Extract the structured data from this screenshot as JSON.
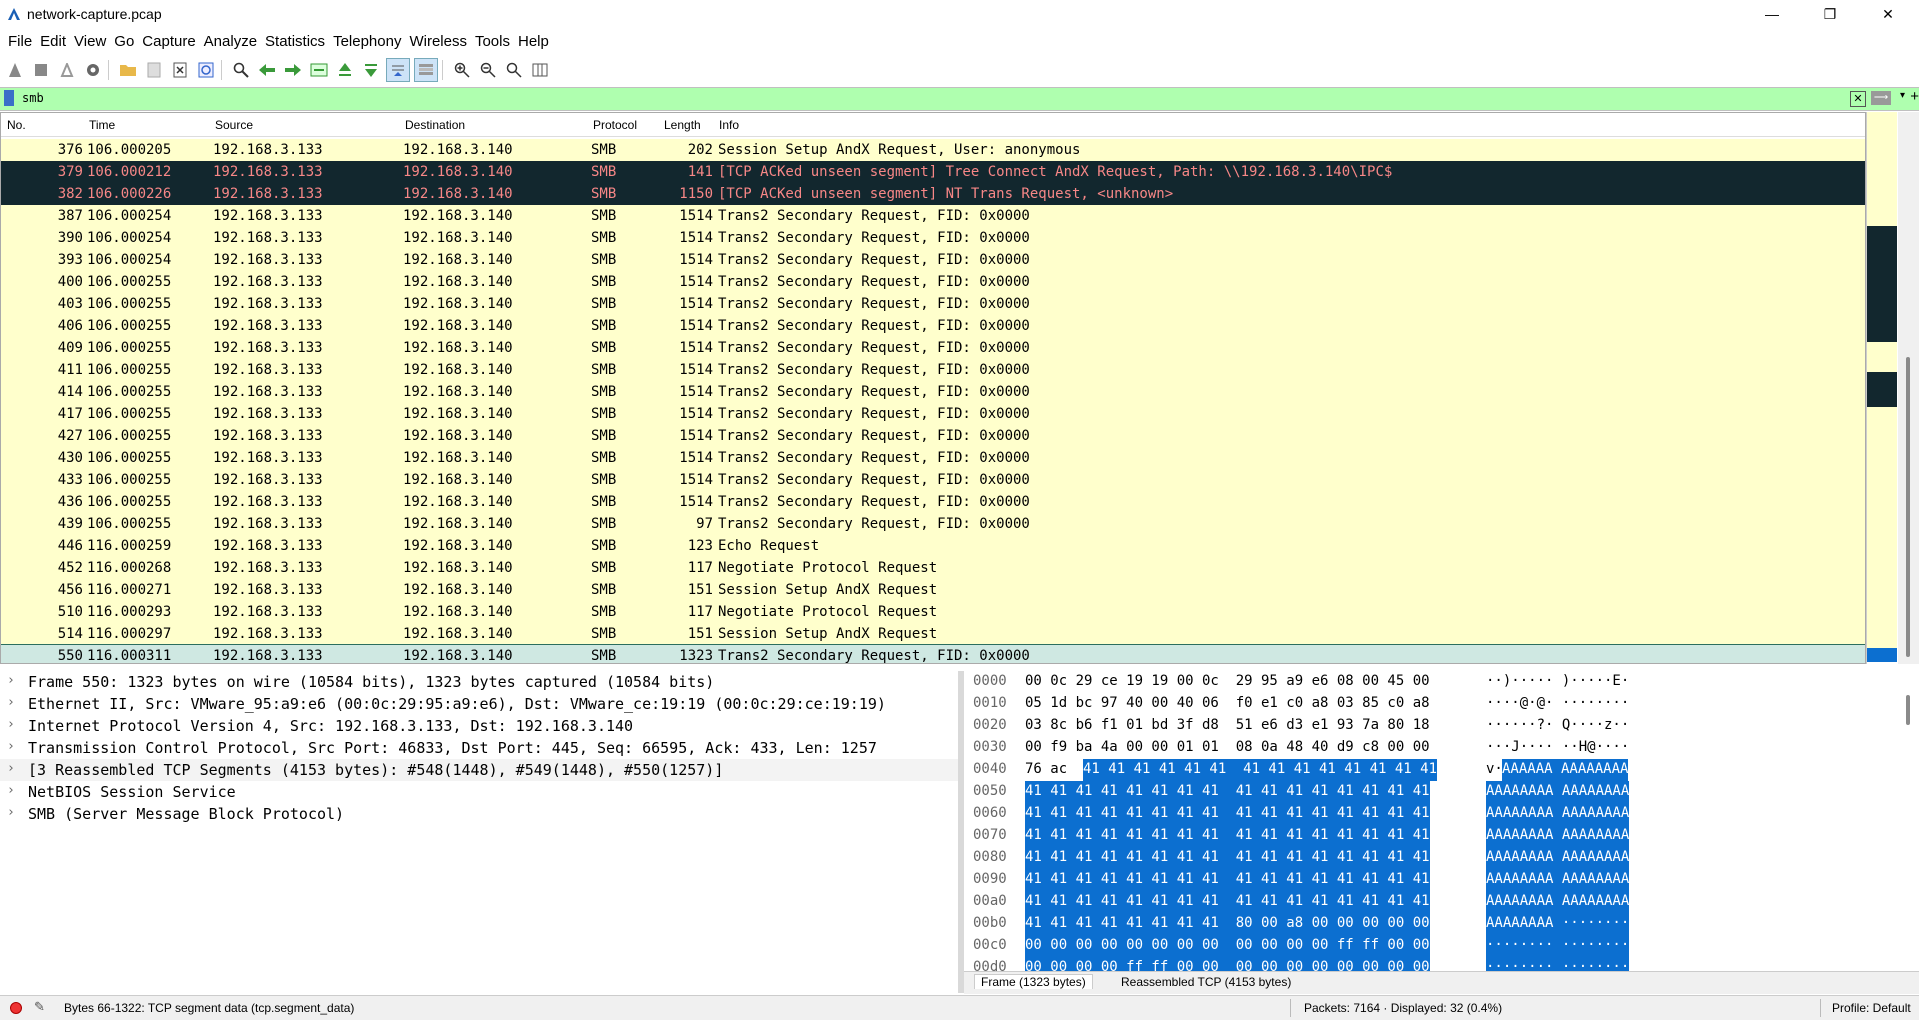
{
  "window": {
    "title": "network-capture.pcap",
    "minimize": "—",
    "restore": "❐",
    "close": "✕"
  },
  "menu": [
    {
      "label": "File",
      "mn": "F"
    },
    {
      "label": "Edit",
      "mn": "E"
    },
    {
      "label": "View",
      "mn": "V"
    },
    {
      "label": "Go",
      "mn": "G"
    },
    {
      "label": "Capture",
      "mn": "C"
    },
    {
      "label": "Analyze",
      "mn": "A"
    },
    {
      "label": "Statistics",
      "mn": "S"
    },
    {
      "label": "Telephony",
      "mn": "y"
    },
    {
      "label": "Wireless",
      "mn": "W"
    },
    {
      "label": "Tools",
      "mn": "T"
    },
    {
      "label": "Help",
      "mn": "H"
    }
  ],
  "filter": {
    "value": "smb",
    "bg_color": "#afffaf"
  },
  "columns": {
    "no": "No.",
    "time": "Time",
    "source": "Source",
    "destination": "Destination",
    "protocol": "Protocol",
    "length": "Length",
    "info": "Info"
  },
  "packets": [
    {
      "no": "376",
      "time": "106.000205",
      "src": "192.168.3.133",
      "dst": "192.168.3.140",
      "proto": "SMB",
      "len": "202",
      "info": "Session Setup AndX Request, User: anonymous",
      "style": "normal"
    },
    {
      "no": "379",
      "time": "106.000212",
      "src": "192.168.3.133",
      "dst": "192.168.3.140",
      "proto": "SMB",
      "len": "141",
      "info": "[TCP ACKed unseen segment] Tree Connect AndX Request, Path: \\\\192.168.3.140\\IPC$",
      "style": "dark"
    },
    {
      "no": "382",
      "time": "106.000226",
      "src": "192.168.3.133",
      "dst": "192.168.3.140",
      "proto": "SMB",
      "len": "1150",
      "info": "[TCP ACKed unseen segment] NT Trans Request, <unknown>",
      "style": "dark"
    },
    {
      "no": "387",
      "time": "106.000254",
      "src": "192.168.3.133",
      "dst": "192.168.3.140",
      "proto": "SMB",
      "len": "1514",
      "info": "Trans2 Secondary Request, FID: 0x0000",
      "style": "normal"
    },
    {
      "no": "390",
      "time": "106.000254",
      "src": "192.168.3.133",
      "dst": "192.168.3.140",
      "proto": "SMB",
      "len": "1514",
      "info": "Trans2 Secondary Request, FID: 0x0000",
      "style": "normal"
    },
    {
      "no": "393",
      "time": "106.000254",
      "src": "192.168.3.133",
      "dst": "192.168.3.140",
      "proto": "SMB",
      "len": "1514",
      "info": "Trans2 Secondary Request, FID: 0x0000",
      "style": "normal"
    },
    {
      "no": "400",
      "time": "106.000255",
      "src": "192.168.3.133",
      "dst": "192.168.3.140",
      "proto": "SMB",
      "len": "1514",
      "info": "Trans2 Secondary Request, FID: 0x0000",
      "style": "normal"
    },
    {
      "no": "403",
      "time": "106.000255",
      "src": "192.168.3.133",
      "dst": "192.168.3.140",
      "proto": "SMB",
      "len": "1514",
      "info": "Trans2 Secondary Request, FID: 0x0000",
      "style": "normal"
    },
    {
      "no": "406",
      "time": "106.000255",
      "src": "192.168.3.133",
      "dst": "192.168.3.140",
      "proto": "SMB",
      "len": "1514",
      "info": "Trans2 Secondary Request, FID: 0x0000",
      "style": "normal"
    },
    {
      "no": "409",
      "time": "106.000255",
      "src": "192.168.3.133",
      "dst": "192.168.3.140",
      "proto": "SMB",
      "len": "1514",
      "info": "Trans2 Secondary Request, FID: 0x0000",
      "style": "normal"
    },
    {
      "no": "411",
      "time": "106.000255",
      "src": "192.168.3.133",
      "dst": "192.168.3.140",
      "proto": "SMB",
      "len": "1514",
      "info": "Trans2 Secondary Request, FID: 0x0000",
      "style": "normal"
    },
    {
      "no": "414",
      "time": "106.000255",
      "src": "192.168.3.133",
      "dst": "192.168.3.140",
      "proto": "SMB",
      "len": "1514",
      "info": "Trans2 Secondary Request, FID: 0x0000",
      "style": "normal"
    },
    {
      "no": "417",
      "time": "106.000255",
      "src": "192.168.3.133",
      "dst": "192.168.3.140",
      "proto": "SMB",
      "len": "1514",
      "info": "Trans2 Secondary Request, FID: 0x0000",
      "style": "normal"
    },
    {
      "no": "427",
      "time": "106.000255",
      "src": "192.168.3.133",
      "dst": "192.168.3.140",
      "proto": "SMB",
      "len": "1514",
      "info": "Trans2 Secondary Request, FID: 0x0000",
      "style": "normal"
    },
    {
      "no": "430",
      "time": "106.000255",
      "src": "192.168.3.133",
      "dst": "192.168.3.140",
      "proto": "SMB",
      "len": "1514",
      "info": "Trans2 Secondary Request, FID: 0x0000",
      "style": "normal"
    },
    {
      "no": "433",
      "time": "106.000255",
      "src": "192.168.3.133",
      "dst": "192.168.3.140",
      "proto": "SMB",
      "len": "1514",
      "info": "Trans2 Secondary Request, FID: 0x0000",
      "style": "normal"
    },
    {
      "no": "436",
      "time": "106.000255",
      "src": "192.168.3.133",
      "dst": "192.168.3.140",
      "proto": "SMB",
      "len": "1514",
      "info": "Trans2 Secondary Request, FID: 0x0000",
      "style": "normal"
    },
    {
      "no": "439",
      "time": "106.000255",
      "src": "192.168.3.133",
      "dst": "192.168.3.140",
      "proto": "SMB",
      "len": "97",
      "info": "Trans2 Secondary Request, FID: 0x0000",
      "style": "normal"
    },
    {
      "no": "446",
      "time": "116.000259",
      "src": "192.168.3.133",
      "dst": "192.168.3.140",
      "proto": "SMB",
      "len": "123",
      "info": "Echo Request",
      "style": "normal"
    },
    {
      "no": "452",
      "time": "116.000268",
      "src": "192.168.3.133",
      "dst": "192.168.3.140",
      "proto": "SMB",
      "len": "117",
      "info": "Negotiate Protocol Request",
      "style": "normal"
    },
    {
      "no": "456",
      "time": "116.000271",
      "src": "192.168.3.133",
      "dst": "192.168.3.140",
      "proto": "SMB",
      "len": "151",
      "info": "Session Setup AndX Request",
      "style": "normal"
    },
    {
      "no": "510",
      "time": "116.000293",
      "src": "192.168.3.133",
      "dst": "192.168.3.140",
      "proto": "SMB",
      "len": "117",
      "info": "Negotiate Protocol Request",
      "style": "normal"
    },
    {
      "no": "514",
      "time": "116.000297",
      "src": "192.168.3.133",
      "dst": "192.168.3.140",
      "proto": "SMB",
      "len": "151",
      "info": "Session Setup AndX Request",
      "style": "normal"
    },
    {
      "no": "550",
      "time": "116.000311",
      "src": "192.168.3.133",
      "dst": "192.168.3.140",
      "proto": "SMB",
      "len": "1323",
      "info": "Trans2 Secondary Request, FID: 0x0000",
      "style": "sel"
    }
  ],
  "details": [
    "Frame 550: 1323 bytes on wire (10584 bits), 1323 bytes captured (10584 bits)",
    "Ethernet II, Src: VMware_95:a9:e6 (00:0c:29:95:a9:e6), Dst: VMware_ce:19:19 (00:0c:29:ce:19:19)",
    "Internet Protocol Version 4, Src: 192.168.3.133, Dst: 192.168.3.140",
    "Transmission Control Protocol, Src Port: 46833, Dst Port: 445, Seq: 66595, Ack: 433, Len: 1257",
    "[3 Reassembled TCP Segments (4153 bytes): #548(1448), #549(1448), #550(1257)]",
    "NetBIOS Session Service",
    "SMB (Server Message Block Protocol)"
  ],
  "hex": [
    {
      "off": "0000",
      "bytes": "00 0c 29 ce 19 19 00 0c  29 95 a9 e6 08 00 45 00",
      "ascii": "··)····· )·····E·"
    },
    {
      "off": "0010",
      "bytes": "05 1d bc 97 40 00 40 06  f0 e1 c0 a8 03 85 c0 a8",
      "ascii": "····@·@· ········"
    },
    {
      "off": "0020",
      "bytes": "03 8c b6 f1 01 bd 3f d8  51 e6 d3 e1 93 7a 80 18",
      "ascii": "······?· Q····z··"
    },
    {
      "off": "0030",
      "bytes": "00 f9 ba 4a 00 00 01 01  08 0a 48 40 d9 c8 00 00",
      "ascii": "···J···· ··H@····"
    },
    {
      "off": "0040",
      "pre": "76 ac ",
      "bytes": "41 41 41 41 41 41  41 41 41 41 41 41 41 41",
      "pre_ascii": "v·",
      "ascii": "AAAAAA AAAAAAAA"
    },
    {
      "off": "0050",
      "bytes": "41 41 41 41 41 41 41 41  41 41 41 41 41 41 41 41",
      "ascii": "AAAAAAAA AAAAAAAA"
    },
    {
      "off": "0060",
      "bytes": "41 41 41 41 41 41 41 41  41 41 41 41 41 41 41 41",
      "ascii": "AAAAAAAA AAAAAAAA"
    },
    {
      "off": "0070",
      "bytes": "41 41 41 41 41 41 41 41  41 41 41 41 41 41 41 41",
      "ascii": "AAAAAAAA AAAAAAAA"
    },
    {
      "off": "0080",
      "bytes": "41 41 41 41 41 41 41 41  41 41 41 41 41 41 41 41",
      "ascii": "AAAAAAAA AAAAAAAA"
    },
    {
      "off": "0090",
      "bytes": "41 41 41 41 41 41 41 41  41 41 41 41 41 41 41 41",
      "ascii": "AAAAAAAA AAAAAAAA"
    },
    {
      "off": "00a0",
      "bytes": "41 41 41 41 41 41 41 41  41 41 41 41 41 41 41 41",
      "ascii": "AAAAAAAA AAAAAAAA"
    },
    {
      "off": "00b0",
      "bytes": "41 41 41 41 41 41 41 41  80 00 a8 00 00 00 00 00",
      "ascii": "AAAAAAAA ········"
    },
    {
      "off": "00c0",
      "bytes": "00 00 00 00 00 00 00 00  00 00 00 00 ff ff 00 00",
      "ascii": "········ ········"
    },
    {
      "off": "00d0",
      "bytes": "00 00 00 00 ff ff 00 00  00 00 00 00 00 00 00 00",
      "ascii": "········ ········"
    }
  ],
  "hex_tabs": {
    "frame": "Frame (1323 bytes)",
    "reassembled": "Reassembled TCP (4153 bytes)"
  },
  "status": {
    "field": "Bytes 66-1322: TCP segment data (tcp.segment_data)",
    "packets": "Packets: 7164 · Displayed: 32 (0.4%)",
    "profile": "Profile: Default"
  },
  "colors": {
    "row_bg": "#ffffcc",
    "dark_bg": "#12272e",
    "dark_fg": "#f78787",
    "selected_bg": "#cfe8e2",
    "hex_highlight": "#0c6fd0"
  }
}
